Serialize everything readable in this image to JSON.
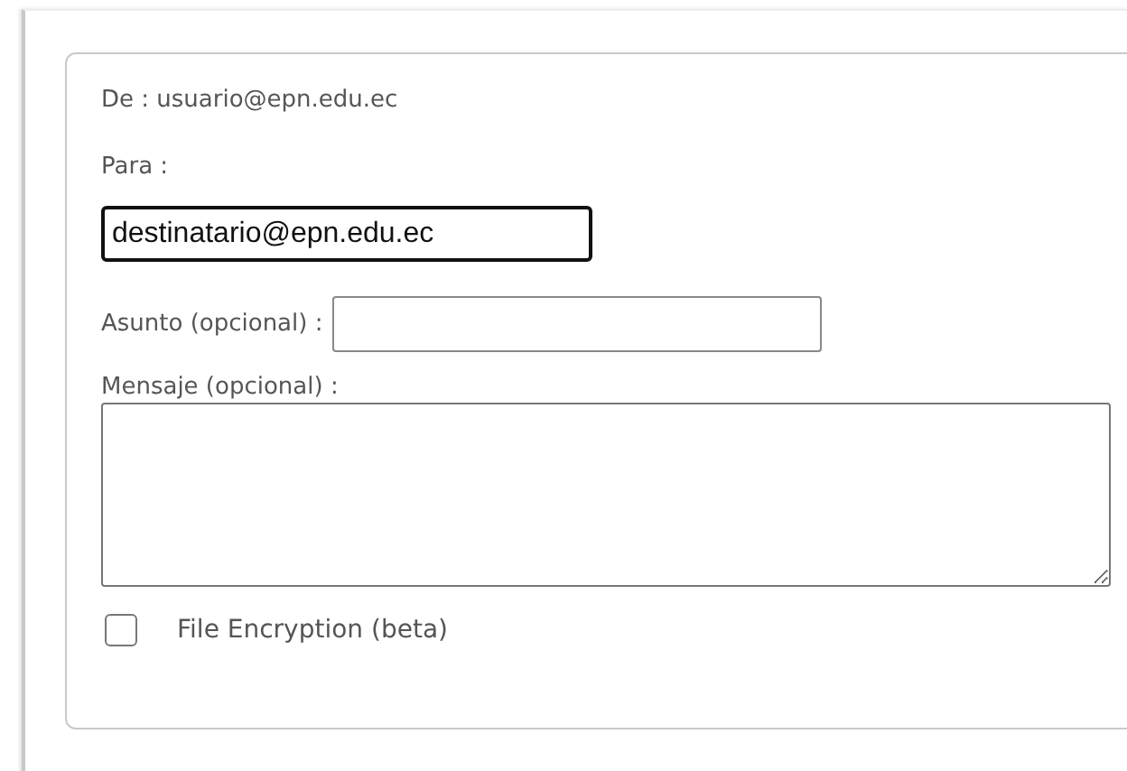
{
  "from": {
    "label": "De :",
    "value": "usuario@epn.edu.ec"
  },
  "to": {
    "label": "Para :",
    "value": "destinatario@epn.edu.ec",
    "focused": true
  },
  "subject": {
    "label": "Asunto (opcional) :"
  },
  "message": {
    "label": "Mensaje (opcional) :"
  },
  "encryption": {
    "label": "File Encryption (beta)",
    "checked": false
  }
}
